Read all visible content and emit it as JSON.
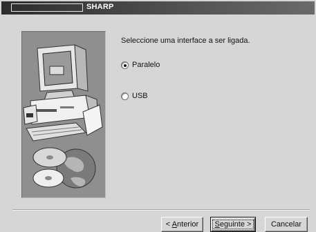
{
  "title_bar": {
    "title": "SHARP"
  },
  "main": {
    "prompt": "Seleccione uma interface a ser ligada.",
    "options": [
      {
        "label": "Paralelo",
        "checked": true
      },
      {
        "label": "USB",
        "checked": false
      }
    ]
  },
  "footer": {
    "back": {
      "prefix": "< ",
      "mnemonic": "A",
      "rest": "nterior"
    },
    "next": {
      "mnemonic": "S",
      "rest": "eguinte >"
    },
    "cancel": "Cancelar"
  },
  "colors": {
    "dialog_bg": "#d6d6d6",
    "title_bar": "#2c2c2c",
    "image_bg": "#8f8f8f"
  },
  "icons": [
    "computer-illustration",
    "cd-discs-illustration",
    "globe-illustration"
  ]
}
